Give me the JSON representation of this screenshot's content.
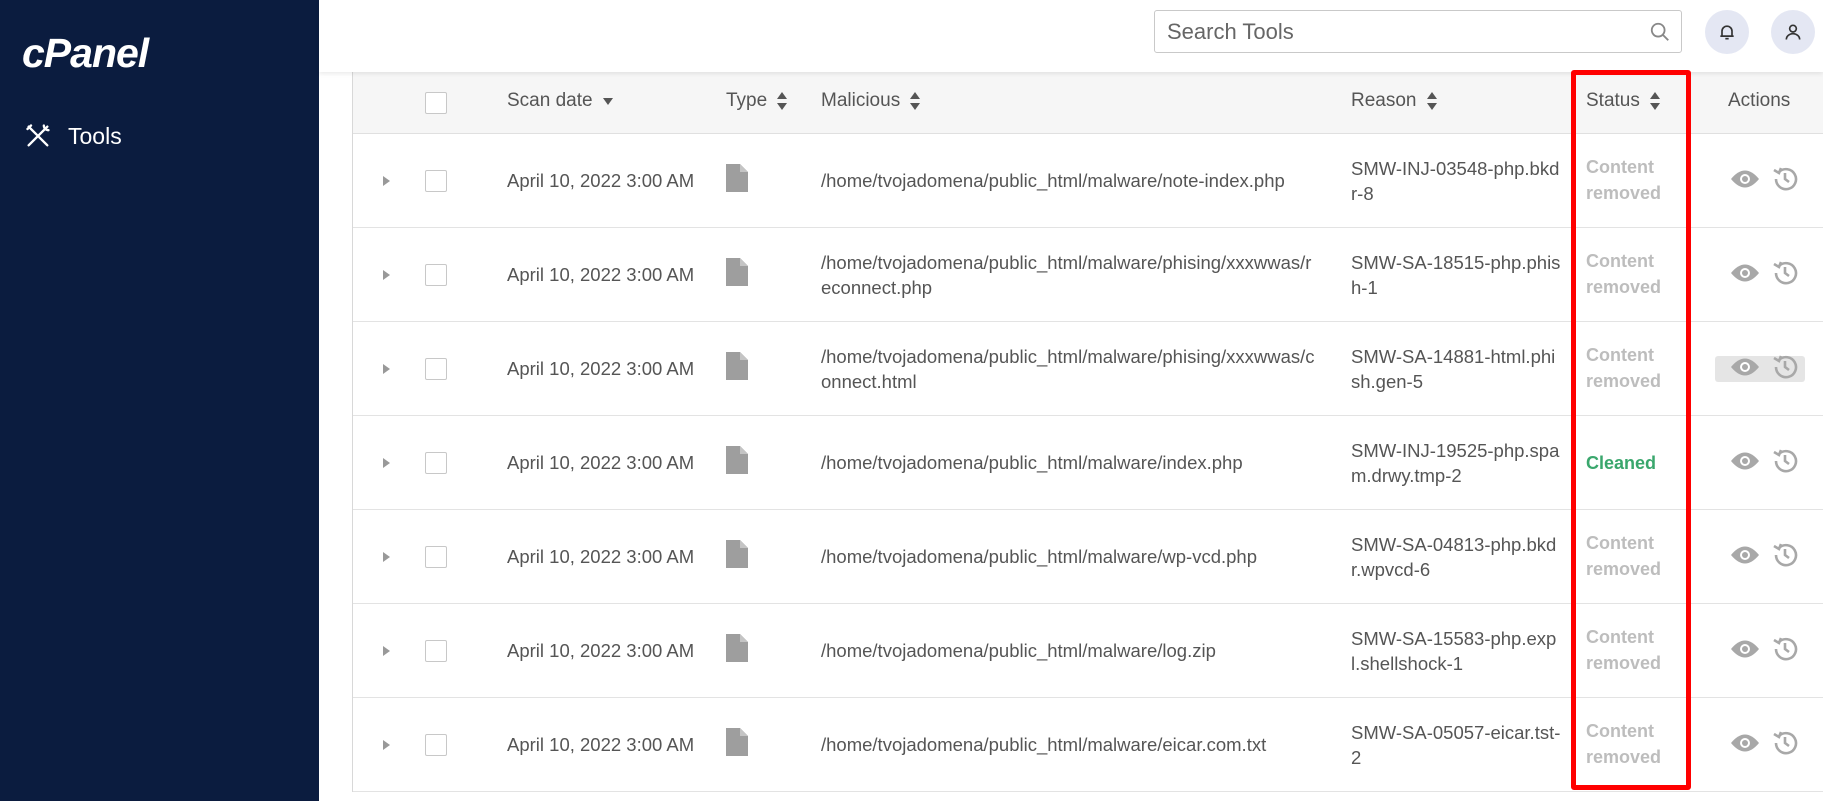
{
  "app": {
    "logo_text": "cPanel"
  },
  "sidebar": {
    "items": [
      {
        "label": "Tools",
        "icon": "tools-icon"
      }
    ]
  },
  "header": {
    "search_placeholder": "Search Tools",
    "icons": [
      "search-icon",
      "bell-icon",
      "user-icon"
    ]
  },
  "table": {
    "columns": {
      "scan_date": "Scan date",
      "type": "Type",
      "malicious": "Malicious",
      "reason": "Reason",
      "status": "Status",
      "actions": "Actions"
    },
    "rows": [
      {
        "date": "April 10, 2022 3:00 AM",
        "path": "/home/tvojadomena/public_html/malware/note-index.php",
        "reason": "SMW-INJ-03548-php.bkdr-8",
        "status": "Content removed"
      },
      {
        "date": "April 10, 2022 3:00 AM",
        "path": "/home/tvojadomena/public_html/malware/phising/xxxwwas/reconnect.php",
        "reason": "SMW-SA-18515-php.phish-1",
        "status": "Content removed"
      },
      {
        "date": "April 10, 2022 3:00 AM",
        "path": "/home/tvojadomena/public_html/malware/phising/xxxwwas/connect.html",
        "reason": "SMW-SA-14881-html.phish.gen-5",
        "status": "Content removed"
      },
      {
        "date": "April 10, 2022 3:00 AM",
        "path": "/home/tvojadomena/public_html/malware/index.php",
        "reason": "SMW-INJ-19525-php.spam.drwy.tmp-2",
        "status": "Cleaned"
      },
      {
        "date": "April 10, 2022 3:00 AM",
        "path": "/home/tvojadomena/public_html/malware/wp-vcd.php",
        "reason": "SMW-SA-04813-php.bkdr.wpvcd-6",
        "status": "Content removed"
      },
      {
        "date": "April 10, 2022 3:00 AM",
        "path": "/home/tvojadomena/public_html/malware/log.zip",
        "reason": "SMW-SA-15583-php.expl.shellshock-1",
        "status": "Content removed"
      },
      {
        "date": "April 10, 2022 3:00 AM",
        "path": "/home/tvojadomena/public_html/malware/eicar.com.txt",
        "reason": "SMW-SA-05057-eicar.tst-2",
        "status": "Content removed"
      }
    ]
  },
  "colors": {
    "sidebar_bg": "#0b1c3f",
    "cleaned": "#3aa76d",
    "removed": "#bdbdbd",
    "highlight": "#ff0000"
  }
}
